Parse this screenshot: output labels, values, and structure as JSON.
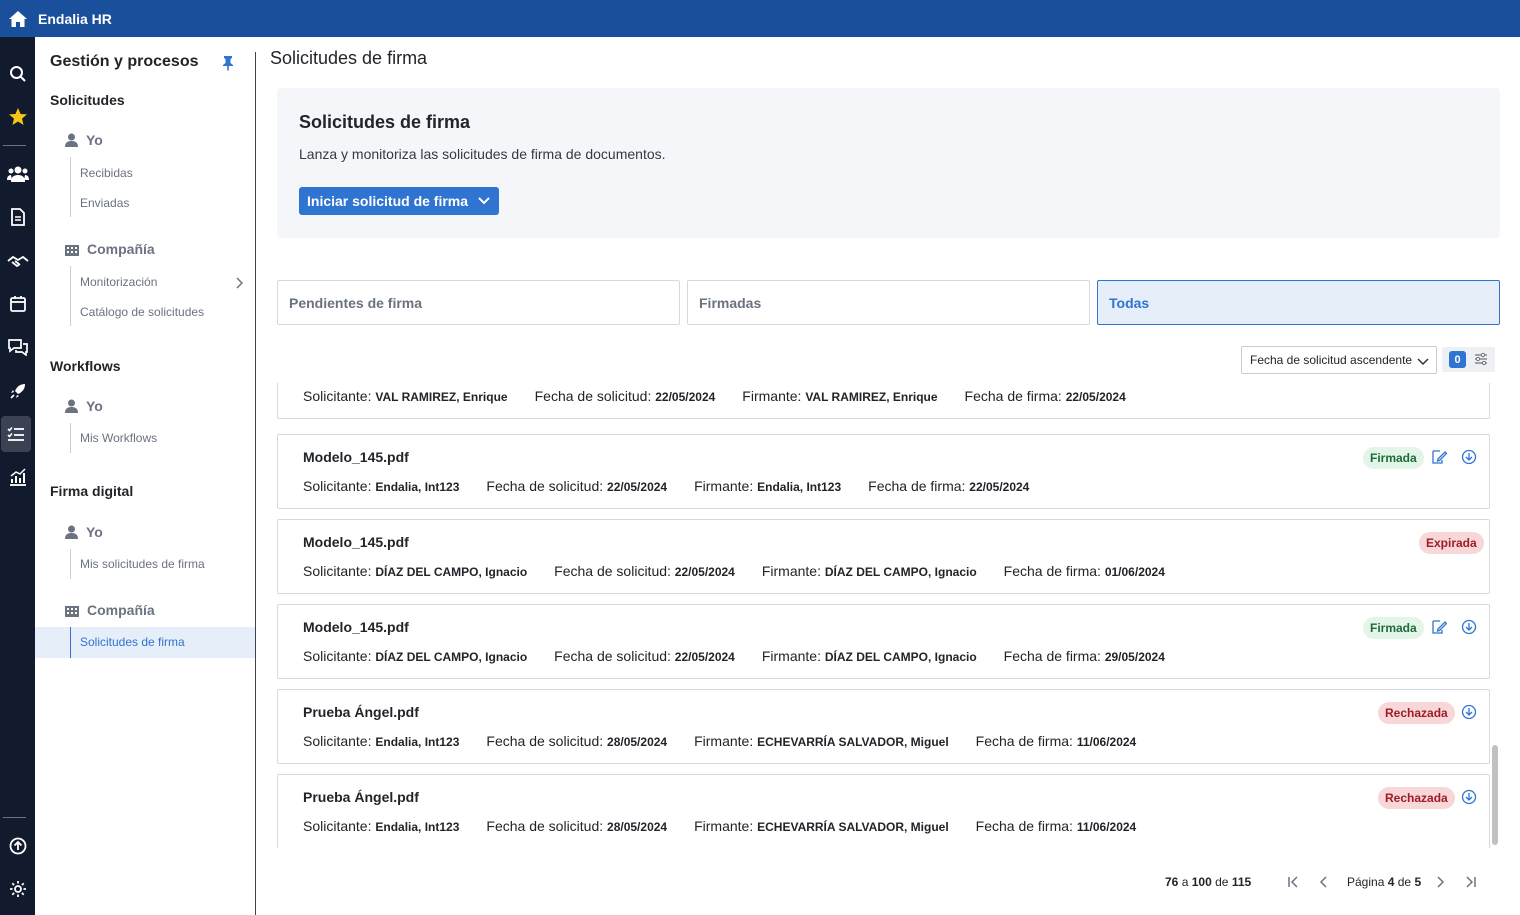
{
  "app": {
    "title": "Endalia HR"
  },
  "sidebar": {
    "header": "Gestión y procesos",
    "sections": [
      {
        "title": "Solicitudes",
        "groups": [
          {
            "label": "Yo",
            "links": [
              "Recibidas",
              "Enviadas"
            ]
          },
          {
            "label": "Compañía",
            "links": [
              "Monitorización",
              "Catálogo de solicitudes"
            ]
          }
        ]
      },
      {
        "title": "Workflows",
        "groups": [
          {
            "label": "Yo",
            "links": [
              "Mis Workflows"
            ]
          }
        ]
      },
      {
        "title": "Firma digital",
        "groups": [
          {
            "label": "Yo",
            "links": [
              "Mis solicitudes de firma"
            ]
          },
          {
            "label": "Compañía",
            "links": [
              "Solicitudes de firma"
            ]
          }
        ]
      }
    ]
  },
  "main": {
    "page_title": "Solicitudes de firma",
    "hero": {
      "title": "Solicitudes de firma",
      "description": "Lanza y monitoriza las solicitudes de firma de documentos.",
      "button": "Iniciar solicitud de firma"
    },
    "tabs": [
      "Pendientes de firma",
      "Firmadas",
      "Todas"
    ],
    "selected_tab": "Todas",
    "sort": {
      "value": "Fecha de solicitud ascendente"
    },
    "filter_count": "0",
    "field_labels": {
      "requester": "Solicitante:",
      "request_date": "Fecha de solicitud:",
      "signer": "Firmante:",
      "sign_date": "Fecha de firma:"
    },
    "partial_row": {
      "requester": "VAL RAMIREZ, Enrique",
      "request_date": "22/05/2024",
      "signer": "VAL RAMIREZ, Enrique",
      "sign_date": "22/05/2024"
    },
    "rows": [
      {
        "file": "Modelo_145.pdf",
        "status": "Firmada",
        "requester": "Endalia, Int123",
        "request_date": "22/05/2024",
        "signer": "Endalia, Int123",
        "sign_date": "22/05/2024"
      },
      {
        "file": "Modelo_145.pdf",
        "status": "Expirada",
        "requester": "DÍAZ DEL CAMPO, Ignacio",
        "request_date": "22/05/2024",
        "signer": "DÍAZ DEL CAMPO, Ignacio",
        "sign_date": "01/06/2024"
      },
      {
        "file": "Modelo_145.pdf",
        "status": "Firmada",
        "requester": "DÍAZ DEL CAMPO, Ignacio",
        "request_date": "22/05/2024",
        "signer": "DÍAZ DEL CAMPO, Ignacio",
        "sign_date": "29/05/2024"
      },
      {
        "file": "Prueba Ángel.pdf",
        "status": "Rechazada",
        "requester": "Endalia, Int123",
        "request_date": "28/05/2024",
        "signer": "ECHEVARRÍA SALVADOR, Miguel",
        "sign_date": "11/06/2024"
      },
      {
        "file": "Prueba Ángel.pdf",
        "status": "Rechazada",
        "requester": "Endalia, Int123",
        "request_date": "28/05/2024",
        "signer": "ECHEVARRÍA SALVADOR, Miguel",
        "sign_date": "11/06/2024"
      }
    ],
    "pagination": {
      "from": "76",
      "a": "a",
      "to": "100",
      "de": "de",
      "total": "115",
      "page_label": "Página",
      "page": "4",
      "of_label": "de",
      "pages": "5"
    }
  },
  "colors": {
    "topbar": "#1a4f9c",
    "rail": "#121a2e",
    "accent": "#2f74d0",
    "signed": "#1e6b3a",
    "rejected": "#9e1c26"
  }
}
